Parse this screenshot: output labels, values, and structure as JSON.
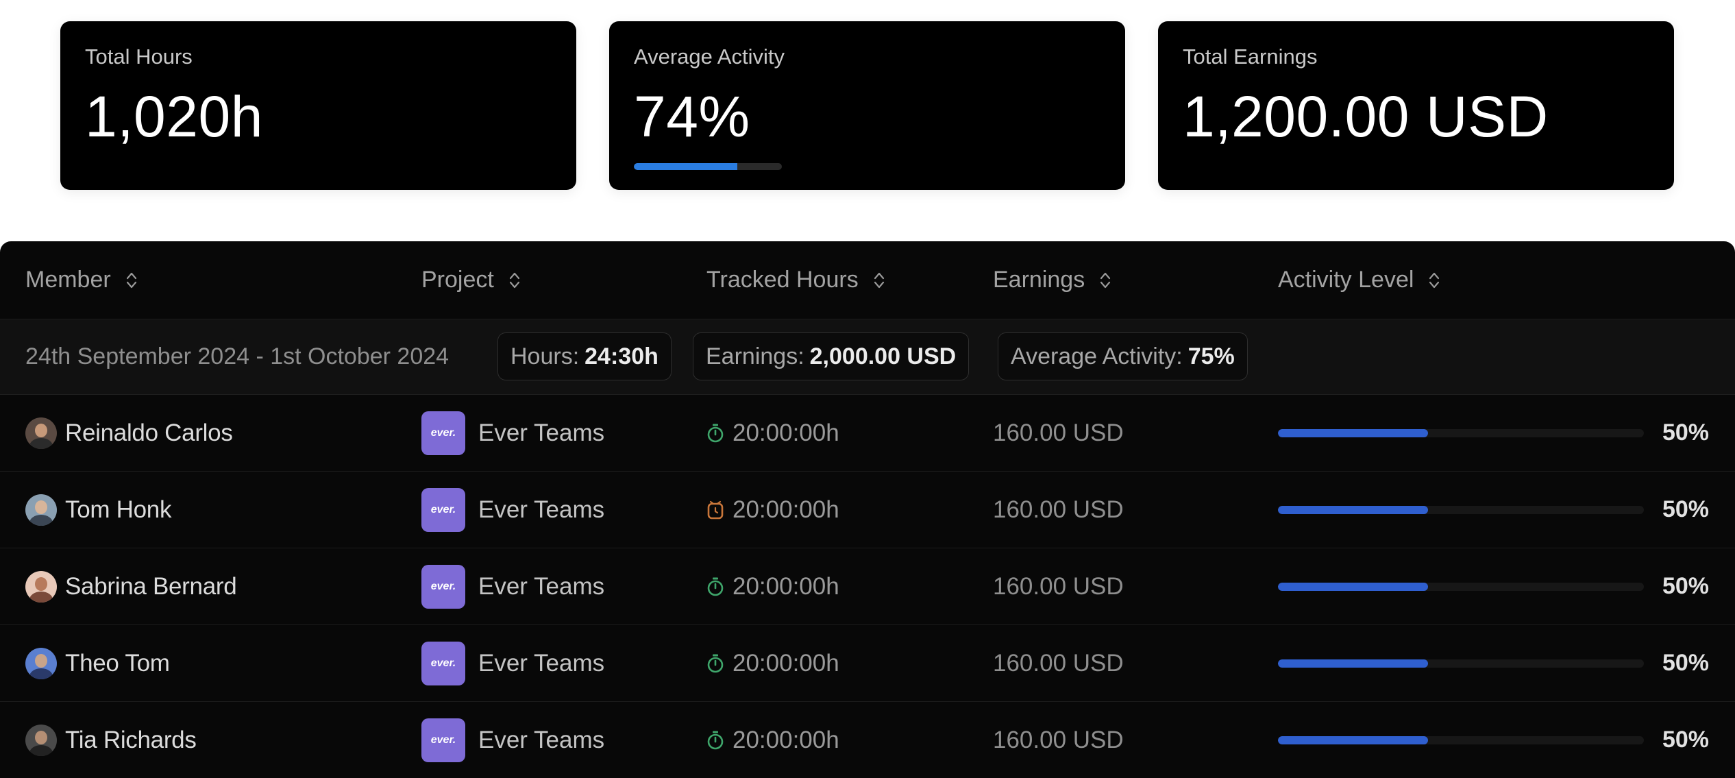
{
  "stats": {
    "total_hours": {
      "label": "Total Hours",
      "value": "1,020h"
    },
    "average_activity": {
      "label": "Average Activity",
      "value": "74%",
      "progress_fraction": 0.7
    },
    "total_earnings": {
      "label": "Total Earnings",
      "value": "1,200.00 USD"
    }
  },
  "table": {
    "columns": [
      {
        "label": "Member",
        "icon": "sort-icon"
      },
      {
        "label": "Project",
        "icon": "sort-icon"
      },
      {
        "label": "Tracked Hours",
        "icon": "sort-icon"
      },
      {
        "label": "Earnings",
        "icon": "sort-icon"
      },
      {
        "label": "Activity Level",
        "icon": "sort-icon"
      }
    ],
    "group": {
      "range": "24th September 2024 - 1st October 2024",
      "hours_label": "Hours:",
      "hours_value": "24:30h",
      "earnings_label": "Earnings:",
      "earnings_value": "2,000.00 USD",
      "activity_label": "Average Activity:",
      "activity_value": "75%"
    },
    "rows": [
      {
        "member": "Reinaldo Carlos",
        "project": "Ever Teams",
        "project_logo": "ever.",
        "timer_icon": "stopwatch-icon",
        "timer_color": "#3fa66b",
        "hours": "20:00:00h",
        "earnings": "160.00 USD",
        "activity": "50%",
        "activity_fraction": 0.41
      },
      {
        "member": "Tom Honk",
        "project": "Ever Teams",
        "project_logo": "ever.",
        "timer_icon": "alarm-clock-icon",
        "timer_color": "#c8763a",
        "hours": "20:00:00h",
        "earnings": "160.00 USD",
        "activity": "50%",
        "activity_fraction": 0.41
      },
      {
        "member": "Sabrina Bernard",
        "project": "Ever Teams",
        "project_logo": "ever.",
        "timer_icon": "stopwatch-icon",
        "timer_color": "#3fa66b",
        "hours": "20:00:00h",
        "earnings": "160.00 USD",
        "activity": "50%",
        "activity_fraction": 0.41
      },
      {
        "member": "Theo Tom",
        "project": "Ever Teams",
        "project_logo": "ever.",
        "timer_icon": "stopwatch-icon",
        "timer_color": "#3fa66b",
        "hours": "20:00:00h",
        "earnings": "160.00 USD",
        "activity": "50%",
        "activity_fraction": 0.41
      },
      {
        "member": "Tia Richards",
        "project": "Ever Teams",
        "project_logo": "ever.",
        "timer_icon": "stopwatch-icon",
        "timer_color": "#3fa66b",
        "hours": "20:00:00h",
        "earnings": "160.00 USD",
        "activity": "50%",
        "activity_fraction": 0.41
      }
    ]
  },
  "colors": {
    "accent_progress": "#2a7de1",
    "activity_bar": "#2f5fcf",
    "project_logo_bg": "#7e6bd6"
  }
}
